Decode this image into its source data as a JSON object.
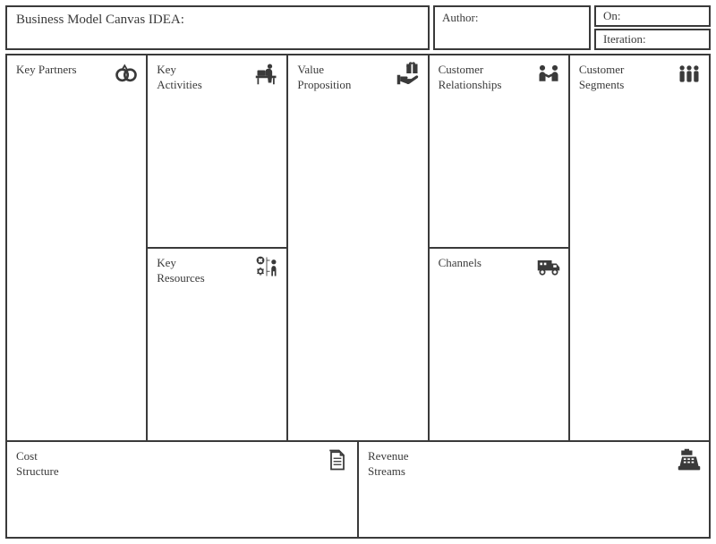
{
  "header": {
    "title_label": "Business Model Canvas IDEA:",
    "author_label": "Author:",
    "on_label": "On:",
    "iteration_label": "Iteration:"
  },
  "blocks": {
    "key_partners": {
      "label": "Key Partners"
    },
    "key_activities": {
      "label": "Key Activities"
    },
    "key_resources": {
      "label": "Key Resources"
    },
    "value_proposition": {
      "label": "Value Proposition"
    },
    "customer_relationships": {
      "label": "Customer Relationships"
    },
    "channels": {
      "label": "Channels"
    },
    "customer_segments": {
      "label": "Customer Segments"
    },
    "cost_structure": {
      "label": "Cost Structure"
    },
    "revenue_streams": {
      "label": "Revenue Streams"
    }
  }
}
